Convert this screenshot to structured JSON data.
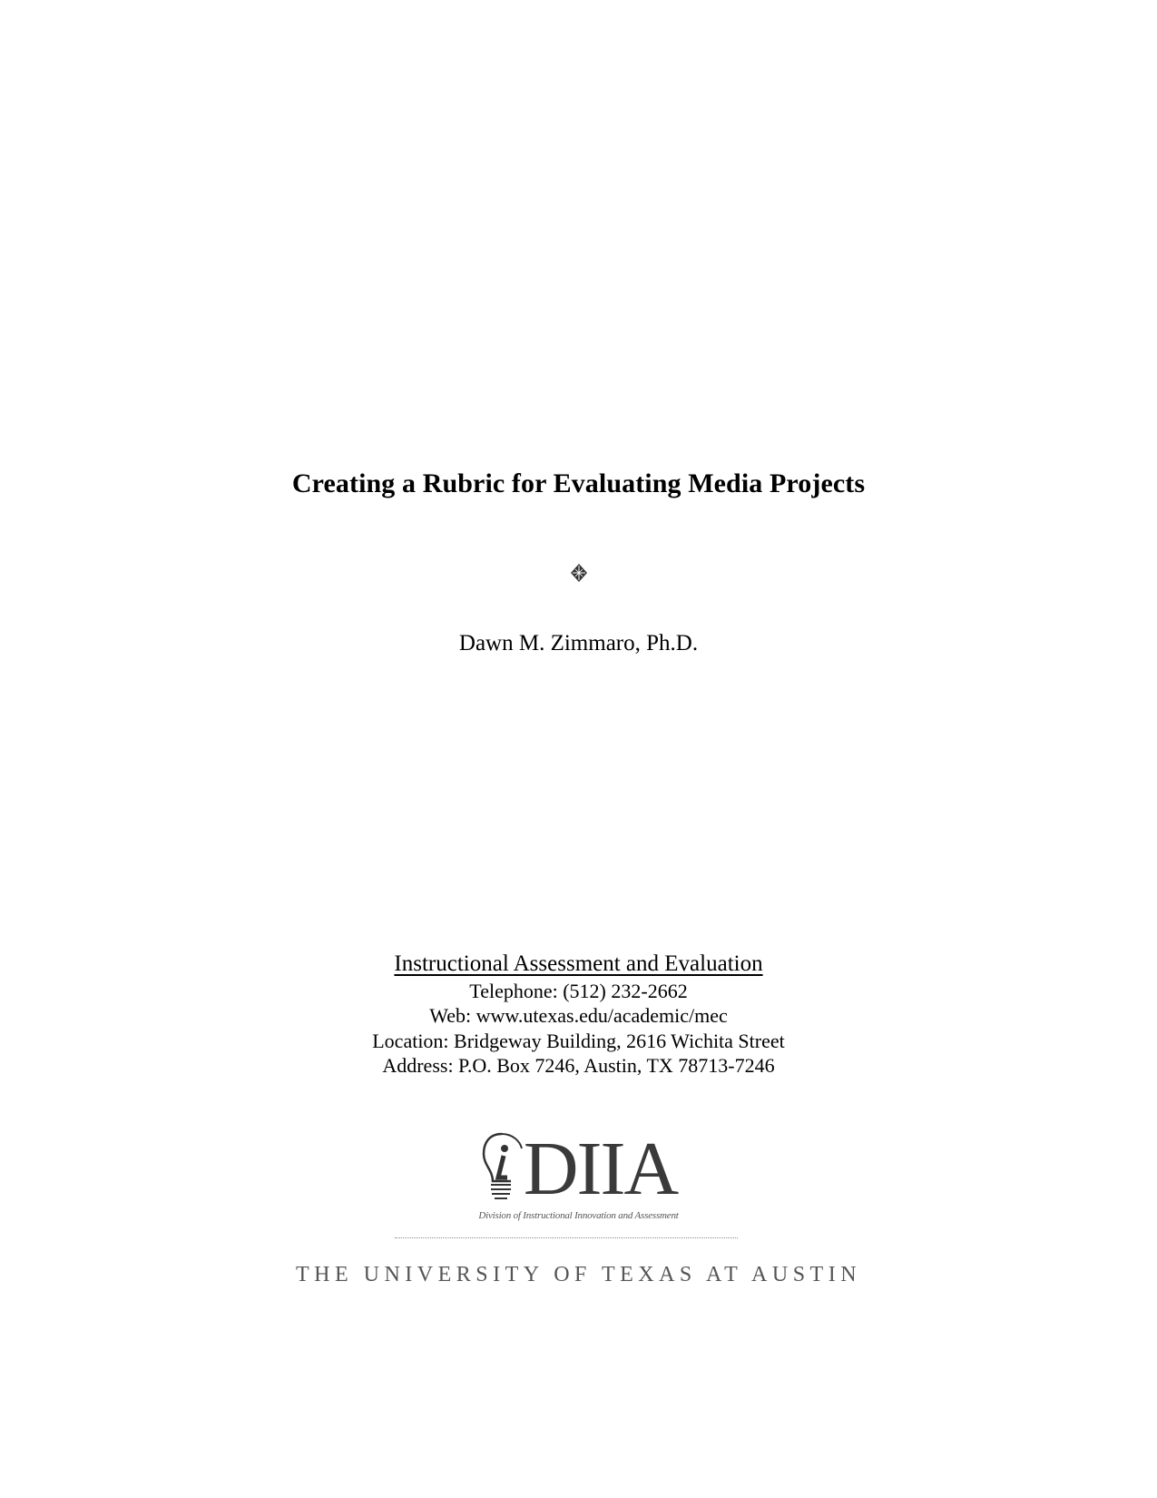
{
  "document": {
    "title": "Creating a Rubric for Evaluating Media Projects",
    "ornament_icon": "diamond-ornament-icon",
    "author": "Dawn M. Zimmaro, Ph.D."
  },
  "organization": {
    "name": "Instructional Assessment and Evaluation",
    "contact": [
      "Telephone: (512) 232-2662",
      "Web: www.utexas.edu/academic/mec",
      "Location: Bridgeway Building, 2616 Wichita Street",
      "Address: P.O. Box 7246, Austin, TX 78713-7246"
    ]
  },
  "logo": {
    "icon": "lightbulb-i-icon",
    "text": "DIIA",
    "tagline": "Division of Instructional Innovation and Assessment"
  },
  "footer": {
    "university": "THE UNIVERSITY OF TEXAS AT AUSTIN"
  }
}
